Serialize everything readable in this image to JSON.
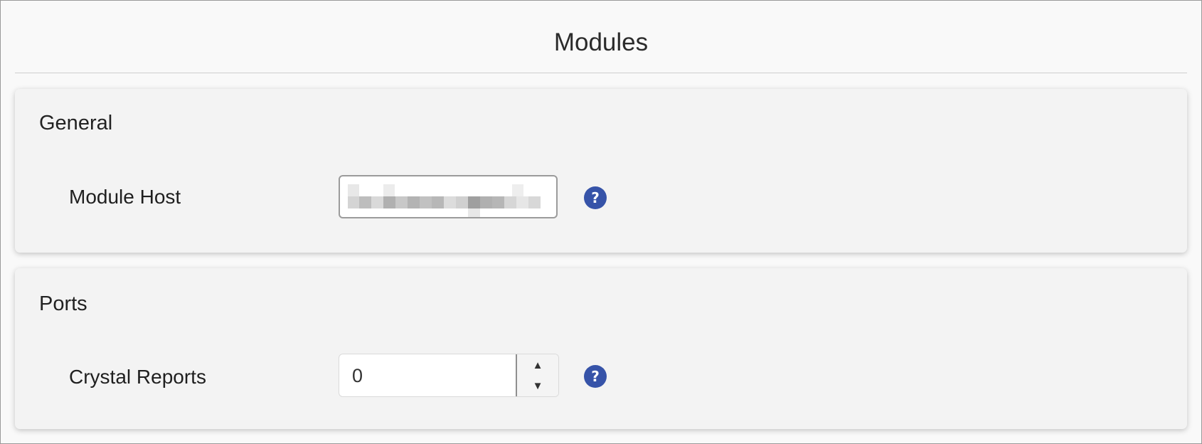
{
  "page": {
    "title": "Modules"
  },
  "general": {
    "title": "General",
    "module_host": {
      "label": "Module Host",
      "value": "",
      "value_note": "redacted / pixelated",
      "help_icon": "question-circle-icon",
      "help_glyph": "?"
    }
  },
  "ports": {
    "title": "Ports",
    "crystal_reports": {
      "label": "Crystal Reports",
      "value": "0",
      "up_glyph": "▲",
      "down_glyph": "▼",
      "help_icon": "question-circle-icon",
      "help_glyph": "?"
    }
  },
  "colors": {
    "accent_help": "#3653a8",
    "card_background": "#f3f3f3",
    "page_background": "#f9f9f9"
  }
}
